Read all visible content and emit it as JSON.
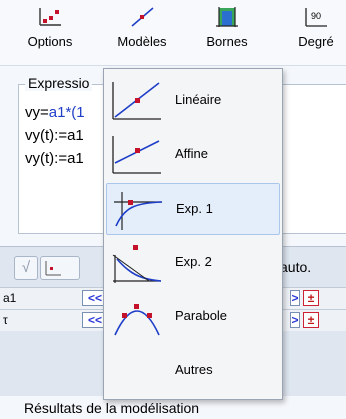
{
  "toolbar": {
    "options_label": "Options",
    "modeles_label": "Modèles",
    "bornes_label": "Bornes",
    "degre_label": "Degré",
    "degre_icon_text": "90"
  },
  "expression": {
    "title": "Expressio",
    "line1_prefix": "vy=",
    "line1_rest": "a1*(1",
    "line2": "vy(t):=a1",
    "line3": "vy(t):=a1"
  },
  "params": {
    "auto_label": "auto.",
    "rows": [
      {
        "name": "a1",
        "dec": "<<",
        "inc": ">",
        "pm": "±"
      },
      {
        "name": "τ",
        "dec": "<<",
        "inc": ">",
        "pm": "±"
      }
    ],
    "check_symbol": "√"
  },
  "results": {
    "title": "Résultats de la modélisation"
  },
  "menu": {
    "items": [
      {
        "label": "Linéaire",
        "icon": "linear-model-icon"
      },
      {
        "label": "Affine",
        "icon": "affine-model-icon"
      },
      {
        "label": "Exp. 1",
        "icon": "exp1-model-icon",
        "highlighted": true
      },
      {
        "label": "Exp. 2",
        "icon": "exp2-model-icon"
      },
      {
        "label": "Parabole",
        "icon": "parabola-model-icon"
      },
      {
        "label": "Autres"
      }
    ]
  },
  "colors": {
    "accent_blue": "#1e3ec8",
    "marker_red": "#c4122b",
    "highlight_bg": "#e4eefb"
  }
}
